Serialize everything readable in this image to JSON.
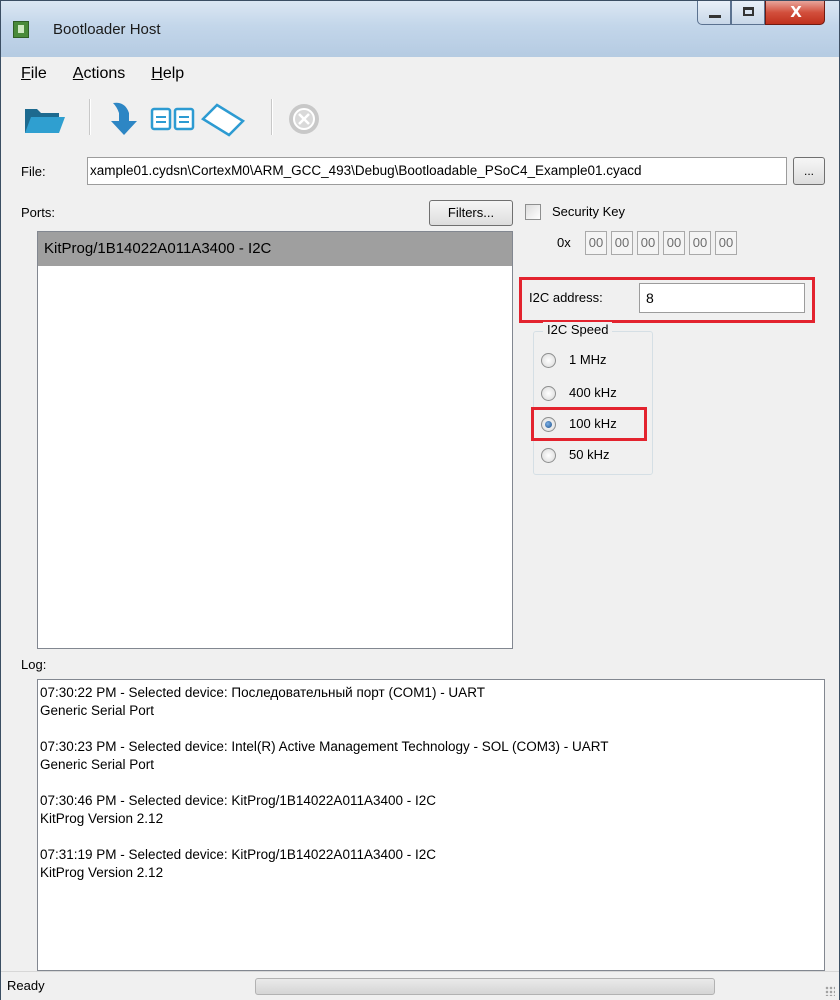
{
  "window": {
    "title": "Bootloader Host",
    "close_glyph": "X"
  },
  "menu": [
    {
      "accel": "F",
      "rest": "ile"
    },
    {
      "accel": "A",
      "rest": "ctions"
    },
    {
      "accel": "H",
      "rest": "elp"
    }
  ],
  "toolbar": {
    "icons": [
      "open-folder-icon",
      "program-download-icon",
      "verify-icon",
      "erase-icon",
      "abort-icon"
    ]
  },
  "file": {
    "label": "File:",
    "path": "xample01.cydsn\\CortexM0\\ARM_GCC_493\\Debug\\Bootloadable_PSoC4_Example01.cyacd",
    "browse_label": "..."
  },
  "ports": {
    "label": "Ports:",
    "filters_label": "Filters...",
    "items": [
      "KitProg/1B14022A011A3400 - I2C"
    ]
  },
  "security_key": {
    "label": "Security Key",
    "prefix": "0x",
    "bytes": [
      "00",
      "00",
      "00",
      "00",
      "00",
      "00"
    ],
    "checked": false
  },
  "i2c": {
    "address_label": "I2C address:",
    "address_value": "8",
    "speed_label": "I2C Speed",
    "speeds": [
      {
        "label": "1 MHz",
        "selected": false
      },
      {
        "label": "400 kHz",
        "selected": false
      },
      {
        "label": "100 kHz",
        "selected": true
      },
      {
        "label": "50 kHz",
        "selected": false
      }
    ]
  },
  "log": {
    "label": "Log:",
    "entries": [
      {
        "line1": "07:30:22 PM - Selected device: Последовательный порт (COM1) - UART",
        "line2": "Generic Serial Port"
      },
      {
        "line1": "07:30:23 PM - Selected device: Intel(R) Active Management Technology - SOL (COM3) - UART",
        "line2": "Generic Serial Port"
      },
      {
        "line1": "07:30:46 PM - Selected device: KitProg/1B14022A011A3400 - I2C",
        "line2": "KitProg Version 2.12"
      },
      {
        "line1": "07:31:19 PM - Selected device: KitProg/1B14022A011A3400 - I2C",
        "line2": "KitProg Version 2.12"
      }
    ]
  },
  "status": {
    "text": "Ready",
    "progress": 0
  },
  "colors": {
    "highlight": "#e3232e",
    "selection": "#9f9f9f",
    "titlebar": "#c3d6ea"
  }
}
